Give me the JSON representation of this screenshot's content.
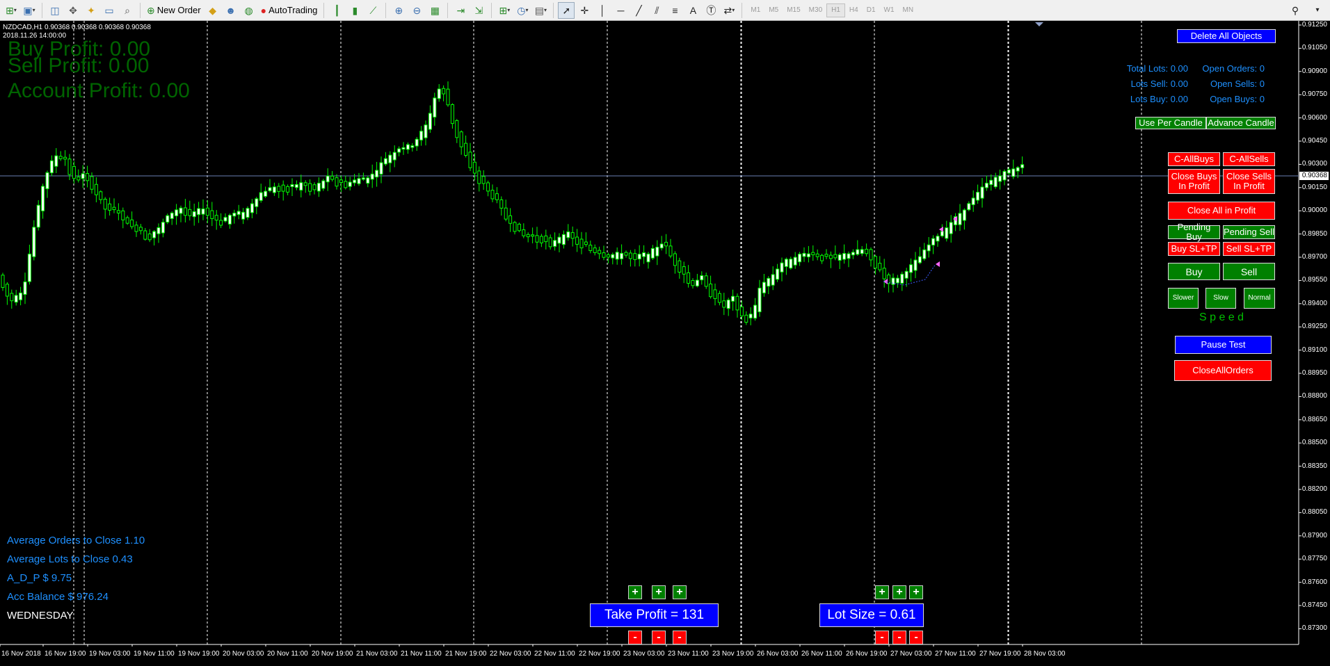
{
  "toolbar": {
    "new_order": "New Order",
    "autotrading": "AutoTrading",
    "timeframes": [
      "M1",
      "M5",
      "M15",
      "M30",
      "H1",
      "H4",
      "D1",
      "W1",
      "MN"
    ],
    "active_timeframe": "H1"
  },
  "chart": {
    "symbol_line": "NZDCAD,H1  0.90368 0.90368 0.90368 0.90368",
    "date_line": "2018.11.26 14:00:00",
    "current_price": "0.90368",
    "price_axis": [
      "0.91250",
      "0.91050",
      "0.90900",
      "0.90750",
      "0.90600",
      "0.90450",
      "0.90300",
      "0.90150",
      "0.90000",
      "0.89850",
      "0.89700",
      "0.89550",
      "0.89400",
      "0.89250",
      "0.89100",
      "0.88950",
      "0.88800",
      "0.88650",
      "0.88500",
      "0.88350",
      "0.88200",
      "0.88050",
      "0.87900",
      "0.87750",
      "0.87600",
      "0.87450",
      "0.87300"
    ],
    "time_axis": [
      "16 Nov 2018",
      "16 Nov 19:00",
      "19 Nov 03:00",
      "19 Nov 11:00",
      "19 Nov 19:00",
      "20 Nov 03:00",
      "20 Nov 11:00",
      "20 Nov 19:00",
      "21 Nov 03:00",
      "21 Nov 11:00",
      "21 Nov 19:00",
      "22 Nov 03:00",
      "22 Nov 11:00",
      "22 Nov 19:00",
      "23 Nov 03:00",
      "23 Nov 11:00",
      "23 Nov 19:00",
      "26 Nov 03:00",
      "26 Nov 11:00",
      "26 Nov 19:00",
      "27 Nov 03:00",
      "27 Nov 11:00",
      "27 Nov 19:00",
      "28 Nov 03:00"
    ]
  },
  "profits": {
    "buy": "Buy Profit: 0.00",
    "sell": "Sell Profit: 0.00",
    "account": "Account Profit: 0.00"
  },
  "stats": {
    "total_lots": "Total Lots: 0.00",
    "open_orders": "Open Orders: 0",
    "lots_sell": "Lots Sell: 0.00",
    "open_sells": "Open Sells: 0",
    "lots_buy": "Lots Buy: 0.00",
    "open_buys": "Open Buys: 0"
  },
  "panel": {
    "delete_all": "Delete All Objects",
    "use_per_candle": "Use Per Candle",
    "advance_candle": "Advance Candle",
    "c_allbuys": "C-AllBuys",
    "c_allsells": "C-AllSells",
    "close_buys_profit": "Close Buys In Profit",
    "close_sells_profit": "Close Sells In Profit",
    "close_all_profit": "Close All in Profit",
    "pending_buy": "Pending Buy",
    "pending_sell": "Pending Sell",
    "buy_sltp": "Buy SL+TP",
    "sell_sltp": "Sell SL+TP",
    "buy": "Buy",
    "sell": "Sell",
    "slower": "Slower",
    "slow": "Slow",
    "normal": "Normal",
    "speed_label": "S p e e d",
    "pause_test": "Pause Test",
    "close_all_orders": "CloseAllOrders"
  },
  "bottom_info": {
    "avg_orders": "Average Orders to Close  1.10",
    "avg_lots": "Average Lots to Close  0.43",
    "adp": "A_D_P $  9.75",
    "acc_balance": "Acc Balance $  976.24",
    "day": "WEDNESDAY"
  },
  "take_profit": {
    "label": "Take Profit = 131",
    "plus": "+",
    "minus": "-"
  },
  "lot_size": {
    "label": "Lot Size = 0.61",
    "plus": "+",
    "minus": "-"
  },
  "colors": {
    "bull_candle": "#ffffff",
    "bear_candle": "#000000",
    "candle_outline": "#00ff00",
    "grid": "#ffffff",
    "price_line": "#6a7fb4"
  }
}
